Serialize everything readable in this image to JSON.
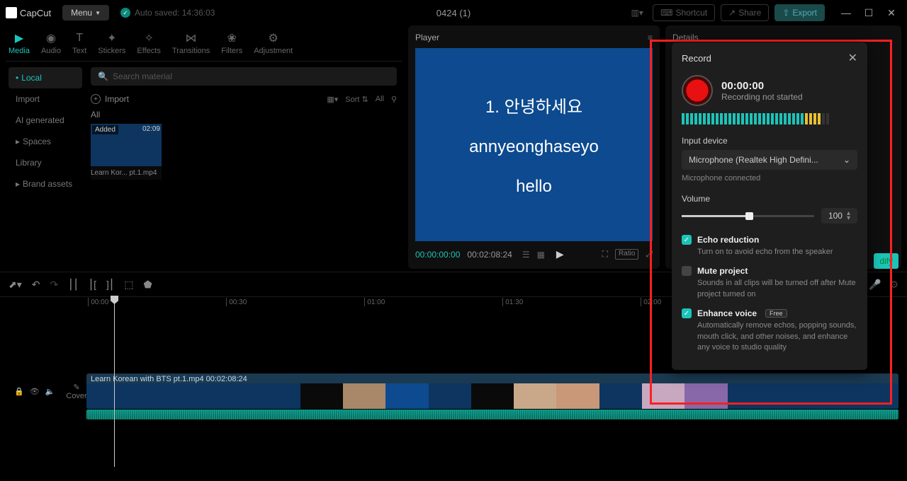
{
  "app": {
    "name": "CapCut",
    "menu": "Menu",
    "autosave": "Auto saved: 14:36:03",
    "project": "0424 (1)"
  },
  "titlebar": {
    "shortcut": "Shortcut",
    "share": "Share",
    "export": "Export"
  },
  "tabs": {
    "media": "Media",
    "audio": "Audio",
    "text": "Text",
    "stickers": "Stickers",
    "effects": "Effects",
    "transitions": "Transitions",
    "filters": "Filters",
    "adjustment": "Adjustment"
  },
  "sidebar": {
    "local": "Local",
    "import": "Import",
    "ai": "AI generated",
    "spaces": "Spaces",
    "library": "Library",
    "brand": "Brand assets"
  },
  "media": {
    "search": "Search material",
    "import": "Import",
    "sort": "Sort",
    "all": "All",
    "all_label": "All",
    "thumb": {
      "badge": "Added",
      "dur": "02:09",
      "name": "Learn Kor... pt.1.mp4"
    }
  },
  "player": {
    "title": "Player",
    "line1": "1. 안녕하세요",
    "line2": "annyeonghaseyo",
    "line3": "hello",
    "cur": "00:00:00:00",
    "total": "00:02:08:24",
    "ratio": "Ratio"
  },
  "details": {
    "title": "Details"
  },
  "timeline": {
    "marks": [
      "00:00",
      "00:30",
      "01:00",
      "01:30",
      "02:00"
    ],
    "clip_label": "Learn Korean with BTS pt.1.mp4   00:02:08:24",
    "cover": "Cover",
    "frame_colors": [
      "#0d3560",
      "#0d3560",
      "#0d3560",
      "#0d3560",
      "#0d3560",
      "#0a0a0a",
      "#a88868",
      "#0d4a8f",
      "#0d3560",
      "#0a0a0a",
      "#c8a888",
      "#c89878",
      "#0d3560",
      "#c8a8c0",
      "#8868a8",
      "#0d3560",
      "#0d3560",
      "#0d3560",
      "#0d3560"
    ]
  },
  "record": {
    "title": "Record",
    "time": "00:00:00",
    "status": "Recording not started",
    "input_label": "Input device",
    "input_value": "Microphone (Realtek High Defini...",
    "mic_status": "Microphone connected",
    "volume_label": "Volume",
    "volume_value": "100",
    "vu_colors": [
      "#1cc4b8",
      "#1cc4b8",
      "#1cc4b8",
      "#1cc4b8",
      "#1cc4b8",
      "#1cc4b8",
      "#1cc4b8",
      "#1cc4b8",
      "#1cc4b8",
      "#1cc4b8",
      "#1cc4b8",
      "#1cc4b8",
      "#1cc4b8",
      "#1cc4b8",
      "#1cc4b8",
      "#1cc4b8",
      "#1cc4b8",
      "#1cc4b8",
      "#1cc4b8",
      "#1cc4b8",
      "#1cc4b8",
      "#1cc4b8",
      "#1cc4b8",
      "#1cc4b8",
      "#1cc4b8",
      "#1cc4b8",
      "#1cc4b8",
      "#1cc4b8",
      "#1cc4b8",
      "#e8c030",
      "#e8c030",
      "#e8c030",
      "#e8c030",
      "#333",
      "#333"
    ],
    "echo": {
      "title": "Echo reduction",
      "desc": "Turn on to avoid echo from the speaker",
      "on": true
    },
    "mute": {
      "title": "Mute project",
      "desc": "Sounds in all clips will be turned off after Mute project turned on",
      "on": false
    },
    "enhance": {
      "title": "Enhance voice",
      "badge": "Free",
      "desc": "Automatically remove echos, popping sounds, mouth click, and other noises, and enhance any voice to studio quality",
      "on": true
    }
  },
  "modify": "dify"
}
